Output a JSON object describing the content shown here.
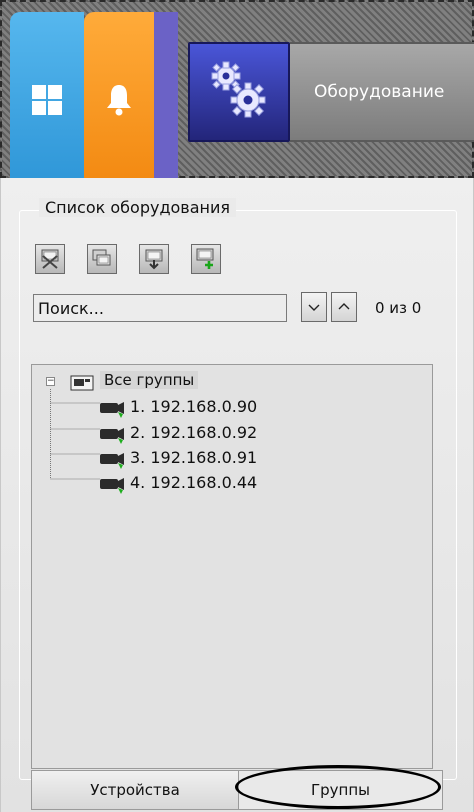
{
  "header": {
    "equipment_label": "Оборудование"
  },
  "panel": {
    "title": "Список оборудования",
    "search": {
      "placeholder": "Поиск..."
    },
    "counter": "0 из 0",
    "tree": {
      "root_label": "Все группы",
      "items": [
        {
          "label": "1. 192.168.0.90"
        },
        {
          "label": "2. 192.168.0.92"
        },
        {
          "label": "3. 192.168.0.91"
        },
        {
          "label": "4. 192.168.0.44"
        }
      ]
    }
  },
  "tabs": {
    "devices": "Устройства",
    "groups": "Группы"
  },
  "icons": [
    "windows-icon",
    "bell-icon",
    "gears-icon",
    "remove-device-icon",
    "copy-device-icon",
    "move-device-icon",
    "add-device-icon",
    "chevron-down-icon",
    "chevron-up-icon",
    "group-icon",
    "camera-icon"
  ],
  "colors": {
    "tile_blue": "#3aa6e6",
    "tile_orange": "#f7961e",
    "tile_purple": "#6b62c6",
    "active_button": "#3038a8"
  }
}
